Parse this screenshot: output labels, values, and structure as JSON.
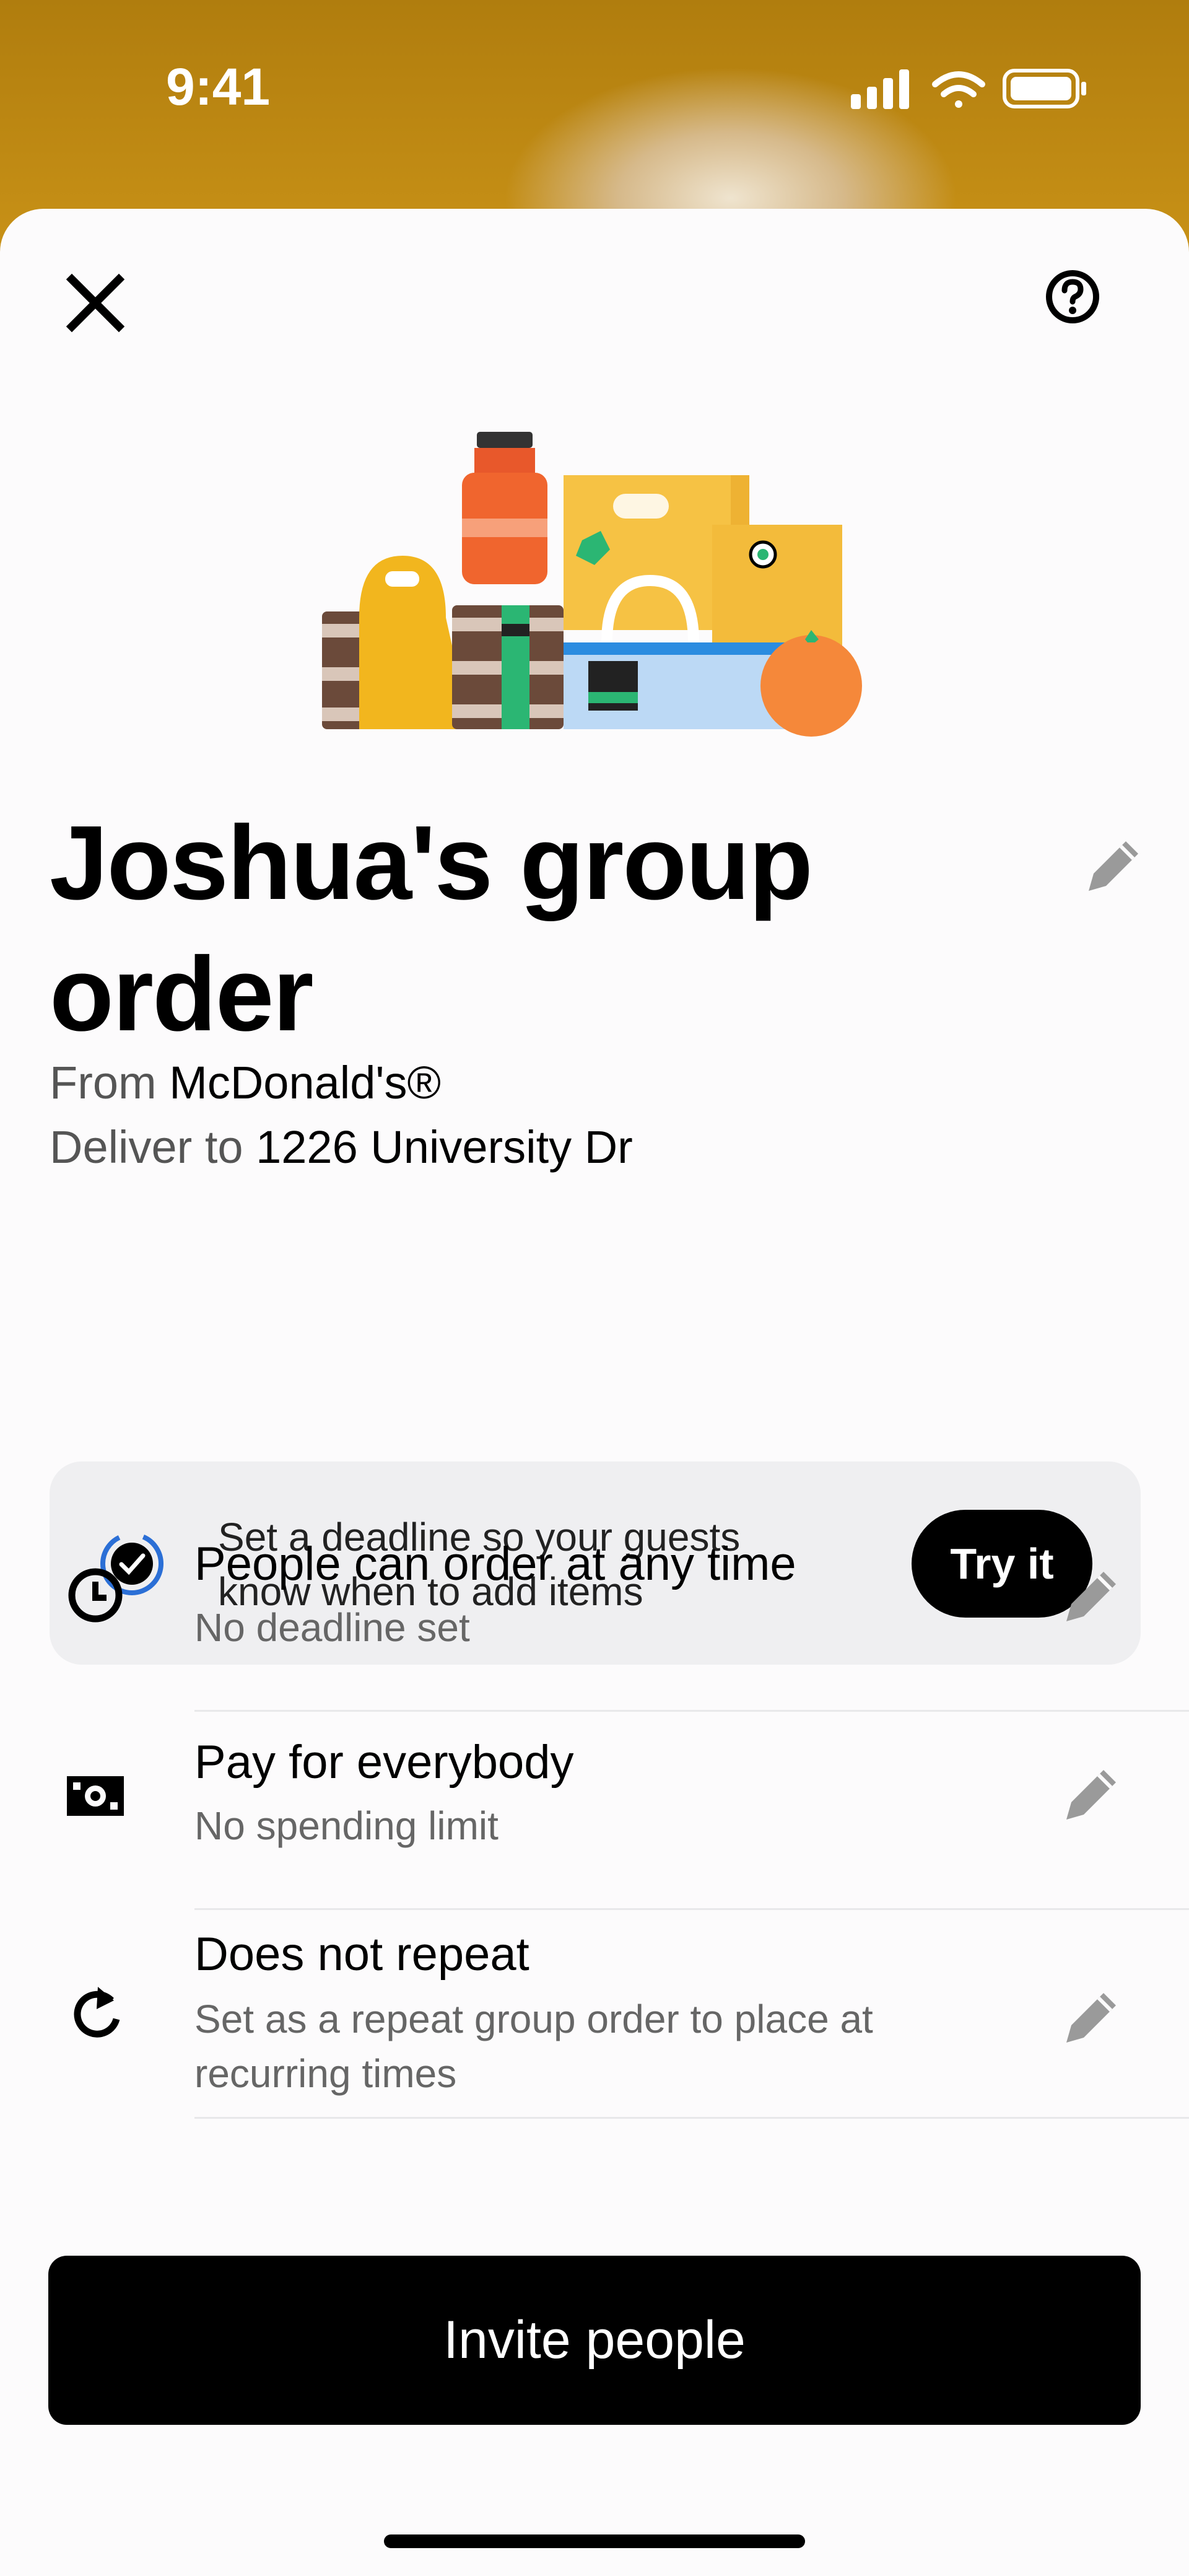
{
  "status_bar": {
    "time": "9:41"
  },
  "header": {
    "close_icon": "close-icon",
    "help_icon": "help-icon"
  },
  "order": {
    "title": "Joshua's group order",
    "from_label": "From",
    "restaurant": "McDonald's®",
    "deliver_label": "Deliver to",
    "address": "1226 University Dr"
  },
  "banner": {
    "text": "Set a deadline so your guests know when to add items",
    "button_label": "Try it"
  },
  "settings": [
    {
      "icon": "clock-icon",
      "title": "People can order at any time",
      "subtitle": "No deadline set"
    },
    {
      "icon": "cash-icon",
      "title": "Pay for everybody",
      "subtitle": "No spending limit"
    },
    {
      "icon": "repeat-icon",
      "title": "Does not repeat",
      "subtitle": "Set as a repeat group order to place at recurring times"
    }
  ],
  "footer": {
    "invite_label": "Invite people"
  }
}
